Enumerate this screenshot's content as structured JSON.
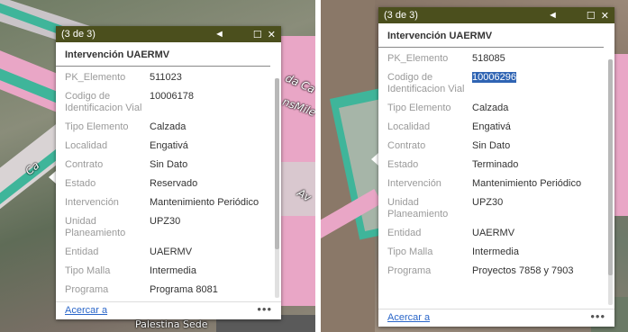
{
  "panels": [
    {
      "header": {
        "counter": "(3 de 3)",
        "prev_icon": "◄",
        "maximize_icon": "☐",
        "close_icon": "✕"
      },
      "title": "Intervención UAERMV",
      "map_labels": [
        "da Ca",
        "nsMile",
        "Av",
        "Ca"
      ],
      "footer_label": "Palestina Sede",
      "rows": [
        {
          "key": "PK_Elemento",
          "value": "511023"
        },
        {
          "key": "Codigo de Identificacion Vial",
          "value": "10006178"
        },
        {
          "key": "Tipo Elemento",
          "value": "Calzada"
        },
        {
          "key": "Localidad",
          "value": "Engativá"
        },
        {
          "key": "Contrato",
          "value": "Sin Dato"
        },
        {
          "key": "Estado",
          "value": "Reservado"
        },
        {
          "key": "Intervención",
          "value": "Mantenimiento Periódico"
        },
        {
          "key": "Unidad Planeamiento",
          "value": "UPZ30"
        },
        {
          "key": "Entidad",
          "value": "UAERMV"
        },
        {
          "key": "Tipo Malla",
          "value": "Intermedia"
        },
        {
          "key": "Programa",
          "value": "Programa 8081"
        }
      ],
      "zoom_link": "Acercar a",
      "more_icon": "•••"
    },
    {
      "header": {
        "counter": "(3 de 3)",
        "prev_icon": "◄",
        "maximize_icon": "☐",
        "close_icon": "✕"
      },
      "title": "Intervención UAERMV",
      "rows": [
        {
          "key": "PK_Elemento",
          "value": "518085"
        },
        {
          "key": "Codigo de Identificacion Vial",
          "value": "10006296",
          "highlighted": true
        },
        {
          "key": "Tipo Elemento",
          "value": "Calzada"
        },
        {
          "key": "Localidad",
          "value": "Engativá"
        },
        {
          "key": "Contrato",
          "value": "Sin Dato"
        },
        {
          "key": "Estado",
          "value": "Terminado"
        },
        {
          "key": "Intervención",
          "value": "Mantenimiento Periódico"
        },
        {
          "key": "Unidad Planeamiento",
          "value": "UPZ30"
        },
        {
          "key": "Entidad",
          "value": "UAERMV"
        },
        {
          "key": "Tipo Malla",
          "value": "Intermedia"
        },
        {
          "key": "Programa",
          "value": "Proyectos 7858 y 7903"
        }
      ],
      "zoom_link": "Acercar a",
      "more_icon": "•••"
    }
  ],
  "colors": {
    "header_bg": "#4b4f1d",
    "link": "#2a66c9",
    "selection": "#2f64b3",
    "road_pink": "#e9a6c6",
    "road_green": "#3fb59a",
    "road_gray": "#c9c4c8"
  }
}
